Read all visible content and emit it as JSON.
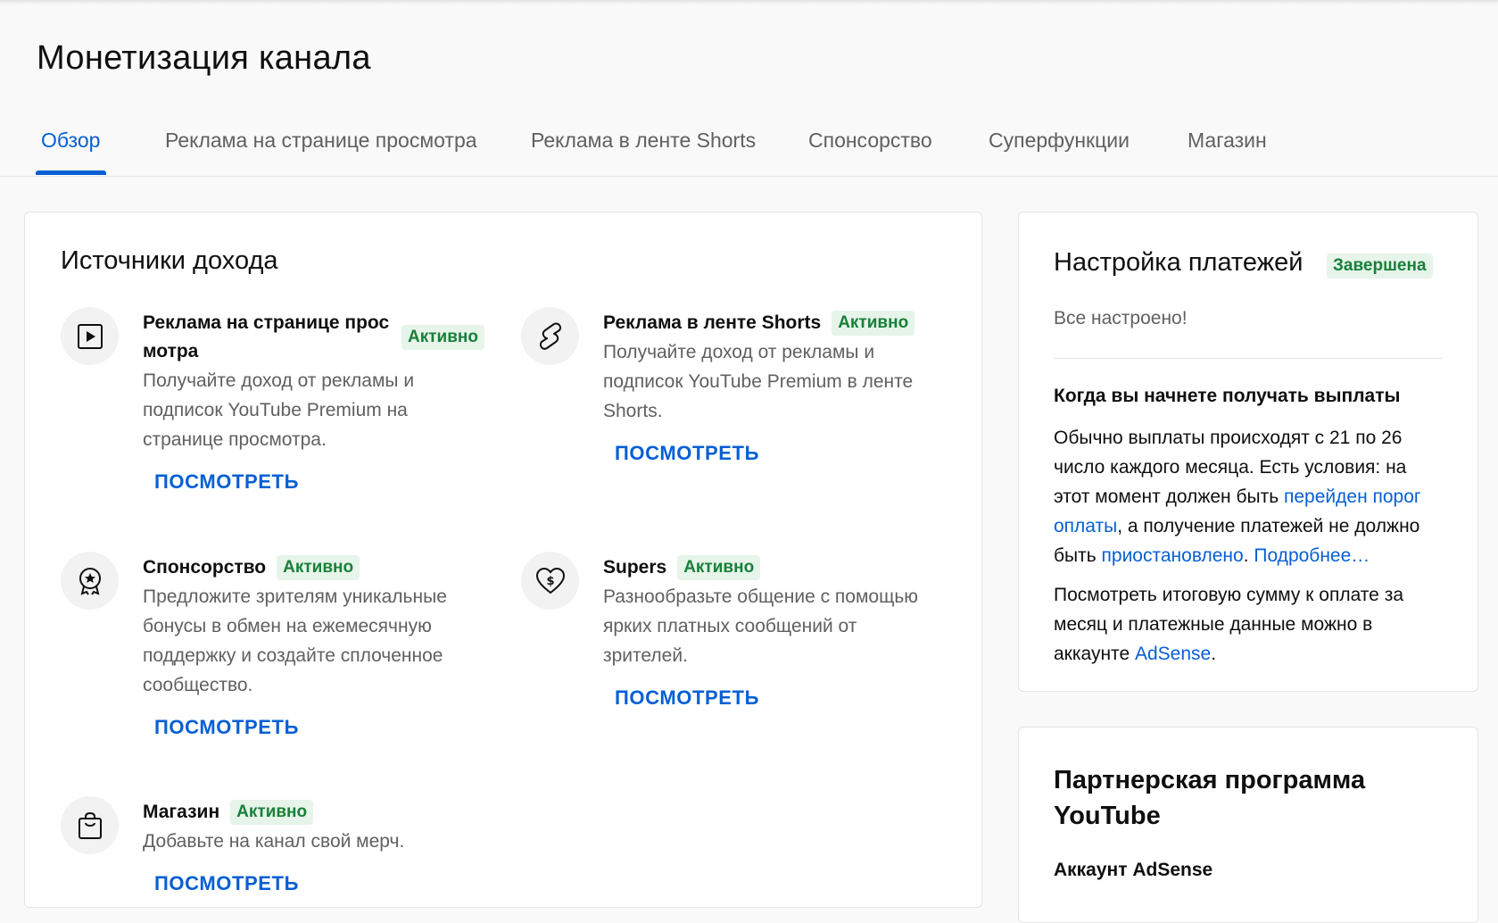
{
  "page_title": "Монетизация канала",
  "tabs": [
    {
      "label": "Обзор",
      "active": true
    },
    {
      "label": "Реклама на странице просмотра",
      "active": false
    },
    {
      "label": "Реклама в ленте Shorts",
      "active": false
    },
    {
      "label": "Спонсорство",
      "active": false
    },
    {
      "label": "Суперфункции",
      "active": false
    },
    {
      "label": "Магазин",
      "active": false
    }
  ],
  "income": {
    "title": "Источники дохода",
    "sources": [
      {
        "icon": "play-icon",
        "title": "Реклама на странице прос мотра",
        "badge": "Активно",
        "desc": "Получайте доход от рекламы и подписок YouTube Premium на странице просмотра.",
        "link": "ПОСМОТРЕТЬ"
      },
      {
        "icon": "shorts-icon",
        "title": "Реклама в ленте Shorts",
        "badge": "Активно",
        "desc": "Получайте доход от рекламы и подписок YouTube Premium в ленте Shorts.",
        "link": "ПОСМОТРЕТЬ"
      },
      {
        "icon": "membership-badge-icon",
        "title": "Спонсорство",
        "badge": "Активно",
        "desc": "Предложите зрителям уникальные бонусы в обмен на ежемесячную поддержку и создайте сплоченное сообщество.",
        "link": "ПОСМОТРЕТЬ"
      },
      {
        "icon": "heart-dollar-icon",
        "title": "Supers",
        "badge": "Активно",
        "desc": "Разнообразьте общение с помощью ярких платных сообщений от зрителей.",
        "link": "ПОСМОТРЕТЬ"
      },
      {
        "icon": "shopping-bag-icon",
        "title": "Магазин",
        "badge": "Активно",
        "desc": "Добавьте на канал свой мерч.",
        "link": "ПОСМОТРЕТЬ"
      }
    ]
  },
  "payments": {
    "title": "Настройка платежей",
    "status": "Завершена",
    "ok_text": "Все настроено!",
    "subtitle": "Когда вы начнете получать выплаты",
    "p1_a": "Обычно выплаты происходят с 21 по 26 число каждого месяца. Есть условия: на этот момент должен быть ",
    "p1_link1": "перейден порог оплаты",
    "p1_b": ", а получение платежей не должно быть ",
    "p1_link2": "приостановлено",
    "p1_c": ". ",
    "p1_link3": "Подробнее…",
    "p2_a": "Посмотреть итоговую сумму к оплате за месяц и платежные данные можно в аккаунте ",
    "p2_link": "AdSense",
    "p2_b": "."
  },
  "partner": {
    "title": "Партнерская программа YouTube",
    "sub": "Аккаунт AdSense"
  },
  "colors": {
    "accent": "#065fd4",
    "badge_bg": "#e6f4ea",
    "badge_text": "#188038"
  }
}
